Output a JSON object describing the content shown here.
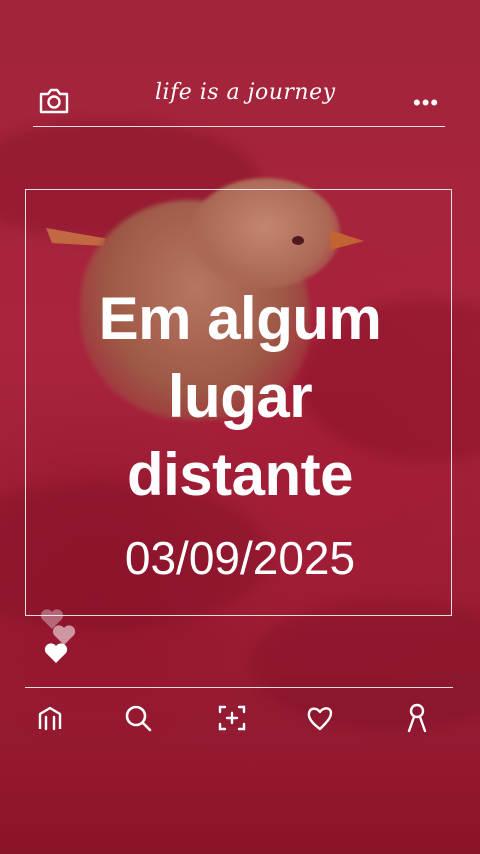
{
  "header": {
    "tagline": "life is a journey",
    "camera_icon": "camera-icon",
    "more_icon": "more-dots-icon",
    "more_glyph": "•••"
  },
  "card": {
    "title_lines": [
      "Em algum",
      "lugar",
      "distante"
    ],
    "date": "03/09/2025"
  },
  "reactions": {
    "icons": [
      "heart-icon",
      "heart-icon",
      "heart-icon"
    ]
  },
  "nav": {
    "items": [
      "home-icon",
      "search-icon",
      "add-photo-icon",
      "heart-icon",
      "profile-icon"
    ]
  },
  "colors": {
    "background": "#a82a40",
    "text": "#ffffff",
    "lines": "#ffffff"
  }
}
